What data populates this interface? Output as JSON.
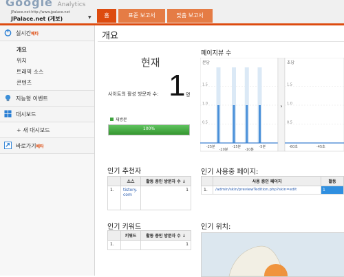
{
  "header": {
    "logo_text": "Google",
    "logo_sub": "Analytics",
    "account_url": "JPalace.net-http://www.jpalace.net",
    "account_name": "JPalace.net (게보)",
    "tabs": [
      "홈",
      "표준 보고서",
      "맞춤 보고서"
    ]
  },
  "sidebar": {
    "realtime": {
      "label": "실시간",
      "badge": "베타"
    },
    "realtime_items": [
      "개요",
      "위치",
      "트래픽 소스",
      "콘텐츠"
    ],
    "sections": [
      {
        "label": "지능형 이벤트"
      },
      {
        "label": "대시보드"
      }
    ],
    "new_dashboard": "+ 새 대시보드",
    "shortcuts": {
      "label": "바로가기",
      "badge": "베타"
    }
  },
  "main": {
    "title": "개요",
    "now_label": "현재",
    "active_label": "사이트의 활성 방문자 수:",
    "active_count": "1",
    "active_unit": "명",
    "legend": "재방문",
    "progress_text": "100%",
    "progress_fraction": 1.0,
    "pageviews_title": "페이지뷰 수"
  },
  "chart_data": {
    "type": "bar",
    "title": "페이지뷰 수",
    "panels": [
      {
        "name": "분당",
        "ylim": [
          0,
          2
        ],
        "yticks": [
          "1.5",
          "1.0",
          "0.5"
        ],
        "xticks": [
          "-25분",
          "-20분",
          "-15분",
          "-10분",
          "-5분"
        ],
        "bar_positions_minutes_ago": [
          -22,
          -16,
          -11,
          -6
        ],
        "bar_values": [
          1,
          1,
          1,
          1
        ]
      },
      {
        "name": "초당",
        "ylim": [
          0,
          2
        ],
        "yticks": [
          "1.5",
          "1.0",
          "0.5"
        ],
        "xticks": [
          "-60초",
          "-45초"
        ],
        "bar_values": []
      }
    ],
    "colors": {
      "bar": "#4a90d9",
      "shade": "#dbe9f6"
    }
  },
  "referrers": {
    "title": "인기 추천자",
    "headers": [
      "",
      "소스",
      "활동 중인 방문자 수 ↓"
    ],
    "rows": [
      {
        "rank": "1.",
        "source": "tistory.com",
        "count": "1"
      }
    ]
  },
  "active_pages": {
    "title": "인기 사용중 페이지:",
    "headers": [
      "",
      "사용 중인 페이지",
      "활동"
    ],
    "rows": [
      {
        "rank": "1.",
        "page": "/admin/skin/previewTedition.php?skin=edit",
        "count": "1"
      }
    ]
  },
  "keywords": {
    "title": "인기 키워드",
    "headers": [
      "",
      "키워드",
      "활동 중인 방문자 수 ↓"
    ],
    "rows": [
      {
        "rank": "1.",
        "keyword": "",
        "count": "1"
      }
    ]
  },
  "locations": {
    "title": "인기 위치:"
  }
}
